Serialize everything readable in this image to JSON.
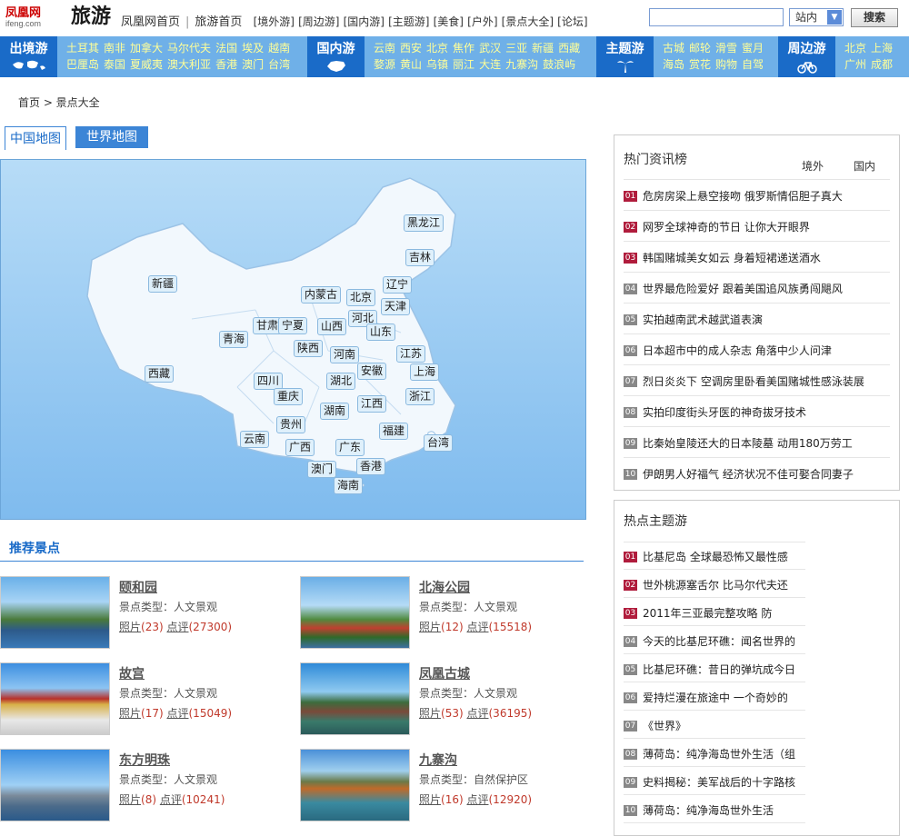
{
  "header": {
    "logo_cn": "凤凰网",
    "logo_en": "ifeng.com",
    "title": "旅游",
    "nav_main": "凤凰网首页",
    "nav_home": "旅游首页",
    "nav_items": [
      "[境外游]",
      "[周边游]",
      "[国内游]",
      "[主题游]",
      "[美食]",
      "[户外]",
      "[景点大全]",
      "[论坛]"
    ],
    "search_placeholder": "",
    "search_scope": "站内",
    "search_button": "搜索"
  },
  "categories": {
    "outbound": {
      "label": "出境游",
      "icon": "world-map-icon",
      "row1": [
        "土耳其",
        "南非",
        "加拿大",
        "马尔代夫",
        "法国",
        "埃及",
        "越南"
      ],
      "row2": [
        "巴厘岛",
        "泰国",
        "夏威夷",
        "澳大利亚",
        "香港",
        "澳门",
        "台湾"
      ]
    },
    "domestic": {
      "label": "国内游",
      "icon": "china-map-icon",
      "row1": [
        "云南",
        "西安",
        "北京",
        "焦作",
        "武汉",
        "三亚",
        "新疆",
        "西藏"
      ],
      "row2": [
        "婺源",
        "黄山",
        "乌镇",
        "丽江",
        "大连",
        "九寨沟",
        "鼓浪屿"
      ]
    },
    "theme": {
      "label": "主题游",
      "icon": "palm-tree-icon",
      "row1": [
        "古城",
        "邮轮",
        "滑雪",
        "蜜月"
      ],
      "row2": [
        "海岛",
        "赏花",
        "购物",
        "自驾"
      ]
    },
    "nearby": {
      "label": "周边游",
      "icon": "bicycle-icon",
      "row1": [
        "北京",
        "上海"
      ],
      "row2": [
        "广州",
        "成都"
      ]
    }
  },
  "breadcrumb": "首页 > 景点大全",
  "map_tabs": {
    "china": "中国地图",
    "world": "世界地图"
  },
  "provinces": [
    "黑龙江",
    "吉林",
    "辽宁",
    "天津",
    "北京",
    "内蒙古",
    "河北",
    "新疆",
    "甘肃",
    "宁夏",
    "山西",
    "山东",
    "青海",
    "陕西",
    "河南",
    "江苏",
    "上海",
    "安徽",
    "西藏",
    "四川",
    "湖北",
    "浙江",
    "重庆",
    "江西",
    "湖南",
    "贵州",
    "福建",
    "云南",
    "广西",
    "广东",
    "台湾",
    "澳门",
    "香港",
    "海南"
  ],
  "recommend": {
    "title": "推荐景点",
    "type_label": "景点类型：",
    "photo_label": "照片",
    "review_label": "点评",
    "spots": [
      {
        "name": "颐和园",
        "type": "人文景观",
        "photos": "(23)",
        "reviews": "(27300)"
      },
      {
        "name": "北海公园",
        "type": "人文景观",
        "photos": "(12)",
        "reviews": "(15518)"
      },
      {
        "name": "故宫",
        "type": "人文景观",
        "photos": "(17)",
        "reviews": "(15049)"
      },
      {
        "name": "凤凰古城",
        "type": "人文景观",
        "photos": "(53)",
        "reviews": "(36195)"
      },
      {
        "name": "东方明珠",
        "type": "人文景观",
        "photos": "(8)",
        "reviews": "(10241)"
      },
      {
        "name": "九寨沟",
        "type": "自然保护区",
        "photos": "(16)",
        "reviews": "(12920)"
      }
    ]
  },
  "hot_news": {
    "title": "热门资讯榜",
    "tab_abroad": "境外",
    "tab_domestic": "国内",
    "items": [
      {
        "n": "01",
        "text": "危房房梁上悬空接吻 俄罗斯情侣胆子真大"
      },
      {
        "n": "02",
        "text": "网罗全球神奇的节日 让你大开眼界"
      },
      {
        "n": "03",
        "text": "韩国赌城美女如云 身着短裙递送酒水"
      },
      {
        "n": "04",
        "text": "世界最危险爱好 跟着美国追风族勇闯飓风"
      },
      {
        "n": "05",
        "text": "实拍越南武术越武道表演"
      },
      {
        "n": "06",
        "text": "日本超市中的成人杂志 角落中少人问津"
      },
      {
        "n": "07",
        "text": "烈日炎炎下 空调房里卧看美国赌城性感泳装展"
      },
      {
        "n": "08",
        "text": "实拍印度街头牙医的神奇拔牙技术"
      },
      {
        "n": "09",
        "text": "比秦始皇陵还大的日本陵墓 动用180万劳工"
      },
      {
        "n": "10",
        "text": "伊朗男人好福气 经济状况不佳可娶合同妻子"
      }
    ]
  },
  "hot_themes": {
    "title": "热点主题游",
    "items": [
      {
        "n": "01",
        "text": "比基尼岛 全球最恐怖又最性感"
      },
      {
        "n": "02",
        "text": "世外桃源塞舌尔 比马尔代夫还"
      },
      {
        "n": "03",
        "text": "2011年三亚最完整攻略 防"
      },
      {
        "n": "04",
        "text": "今天的比基尼环礁：闻名世界的"
      },
      {
        "n": "05",
        "text": "比基尼环礁：昔日的弹坑成今日"
      },
      {
        "n": "06",
        "text": "爱持烂漫在旅途中 一个奇妙的"
      },
      {
        "n": "07",
        "text": "《世界》"
      },
      {
        "n": "08",
        "text": "薄荷岛：纯净海岛世外生活（组"
      },
      {
        "n": "09",
        "text": "史料揭秘：美军战后的十字路核"
      },
      {
        "n": "10",
        "text": "薄荷岛：纯净海岛世外生活"
      }
    ]
  },
  "colors": {
    "accent": "#1a6bc8",
    "catbar": "#6fb0e8",
    "rank_red": "#b01c3c",
    "link_yellow": "#ffff99"
  }
}
